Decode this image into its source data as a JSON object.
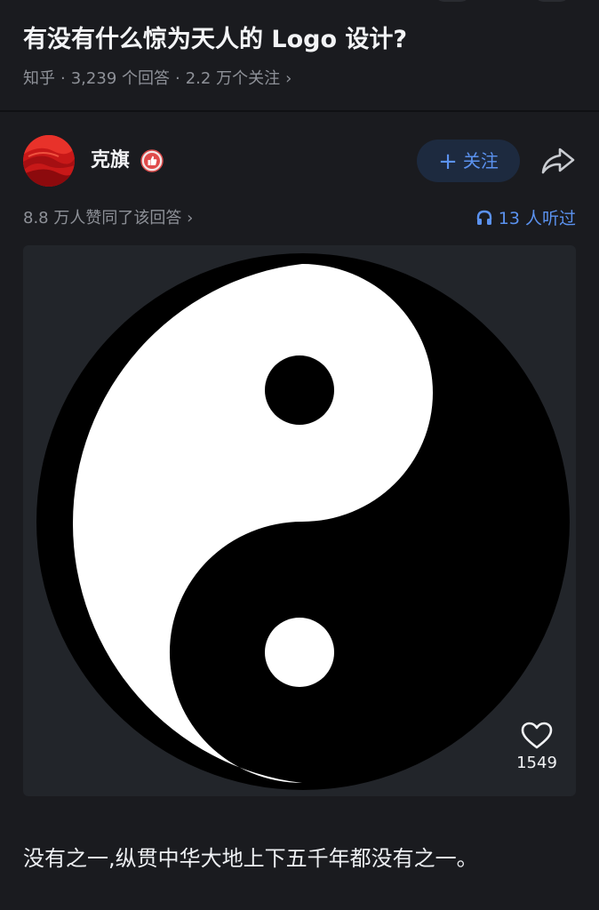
{
  "question": {
    "title": "有没有什么惊为天人的 Logo 设计?",
    "source": "知乎",
    "answer_count": "3,239 个回答",
    "follower_count": "2.2 万个关注",
    "separator": "·",
    "chevron": "›"
  },
  "author": {
    "name": "克旗",
    "avatar_icon": "avatar-red-wave",
    "badge_icon": "thumbs-up-badge-icon",
    "follow_label": "关注",
    "follow_plus": "+",
    "share_icon": "share-icon"
  },
  "stats": {
    "likes_text": "8.8 万人赞同了该回答",
    "likes_chevron": "›",
    "listen_text": "13 人听过",
    "listen_icon": "headphone-icon"
  },
  "image": {
    "subject": "yin-yang-symbol",
    "like_icon": "heart-icon",
    "like_count": "1549"
  },
  "answer": {
    "text": "没有之一,纵贯中华大地上下五千年都没有之一。"
  },
  "colors": {
    "background": "#1a1b1f",
    "card": "#22252a",
    "accent": "#5b92ef",
    "follow_bg": "#1d2a3f",
    "muted_text": "#8e9198",
    "avatar_red": "#d11f1f"
  }
}
